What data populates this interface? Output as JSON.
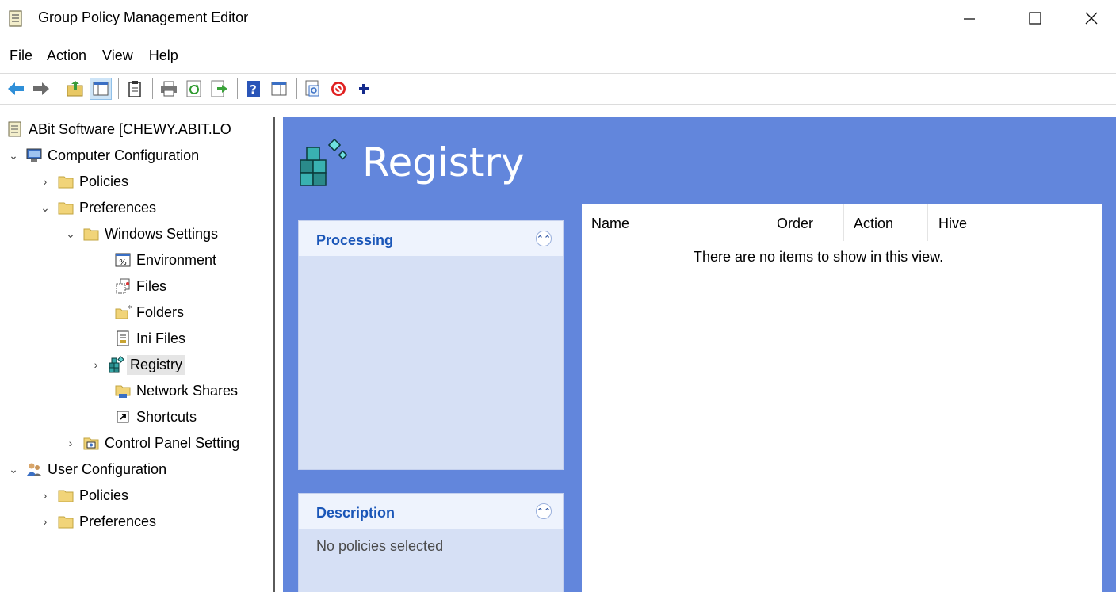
{
  "window": {
    "title": "Group Policy Management Editor",
    "controls": {
      "minimize": "—",
      "maximize": "☐",
      "close": "✕"
    }
  },
  "menu": [
    "File",
    "Action",
    "View",
    "Help"
  ],
  "toolbar": {
    "icons": [
      "back-arrow-icon",
      "forward-arrow-icon",
      "up-folder-icon",
      "show-hide-tree-icon",
      "clipboard-icon",
      "print-icon",
      "refresh-icon",
      "export-icon",
      "help-icon",
      "properties-icon",
      "preview-icon",
      "stop-icon",
      "add-icon"
    ]
  },
  "tree": {
    "root": "ABit Software [CHEWY.ABIT.LO",
    "computer_configuration": "Computer Configuration",
    "cc_policies": "Policies",
    "cc_preferences": "Preferences",
    "windows_settings": "Windows Settings",
    "environment": "Environment",
    "files": "Files",
    "folders": "Folders",
    "ini_files": "Ini Files",
    "registry": "Registry",
    "network_shares": "Network Shares",
    "shortcuts": "Shortcuts",
    "control_panel_settings": "Control Panel Setting",
    "user_configuration": "User Configuration",
    "uc_policies": "Policies",
    "uc_preferences": "Preferences"
  },
  "main": {
    "title": "Registry",
    "processing": {
      "title": "Processing"
    },
    "description": {
      "title": "Description",
      "text": "No policies selected"
    },
    "list": {
      "columns": [
        "Name",
        "Order",
        "Action",
        "Hive"
      ],
      "empty_message": "There are no items to show in this view."
    }
  },
  "colors": {
    "pane_background": "#6286dc",
    "panel_title": "#1a56b8",
    "panel_body": "#d6e0f5"
  }
}
